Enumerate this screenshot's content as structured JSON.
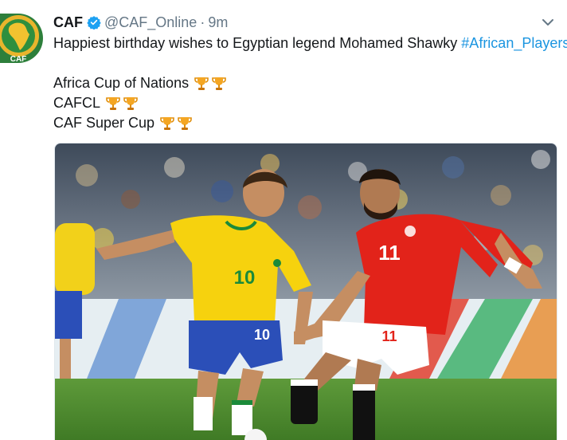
{
  "tweet": {
    "author": {
      "avatar_text": "CAF",
      "name": "CAF",
      "handle": "@CAF_Online",
      "separator": "·",
      "time": "9m"
    },
    "text_lines": {
      "intro": "Happiest birthday wishes to Egyptian legend Mohamed Shawky",
      "hashtag": "#African_Players",
      "title_1": "Africa Cup of Nations",
      "title_2": "CAFCL",
      "title_3": "CAF Super Cup"
    },
    "photo": {
      "left_shirt_number": "10",
      "right_shirt_number": "11"
    }
  },
  "colors": {
    "link": "#1b95e0",
    "verified": "#1da1f2",
    "secondary_text": "#657786",
    "egypt_red": "#e2231a",
    "brazil_yellow": "#f6d20e",
    "brazil_blue": "#2b4fb8"
  }
}
